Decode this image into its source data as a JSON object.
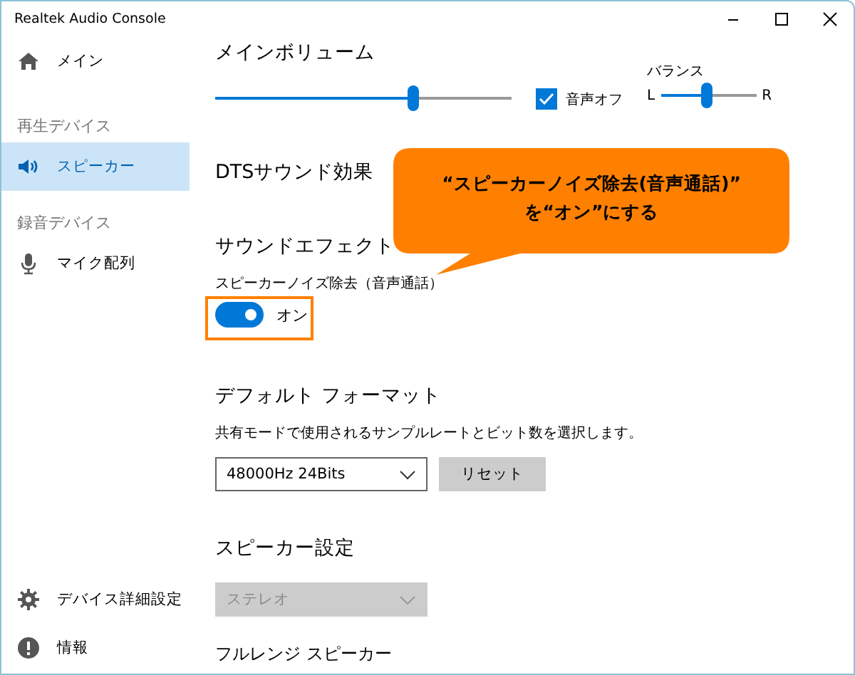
{
  "window": {
    "title": "Realtek Audio Console"
  },
  "sidebar": {
    "items": [
      {
        "kind": "link",
        "label": "メイン",
        "selected": false
      },
      {
        "kind": "header",
        "label": "再生デバイス"
      },
      {
        "kind": "link",
        "label": "スピーカー",
        "selected": true
      },
      {
        "kind": "header",
        "label": "録音デバイス"
      },
      {
        "kind": "link",
        "label": "マイク配列",
        "selected": false
      }
    ],
    "bottom_items": [
      {
        "kind": "link",
        "label": "デバイス詳細設定",
        "selected": false
      },
      {
        "kind": "link",
        "label": "情報",
        "selected": false
      }
    ]
  },
  "main_volume": {
    "title": "メインボリューム",
    "level": 0.67,
    "mute": {
      "label": "音声オフ",
      "checked": true
    },
    "balance": {
      "label": "バランス",
      "left": "L",
      "right": "R",
      "level": 0.49
    }
  },
  "dts": {
    "title": "DTSサウンド効果"
  },
  "sound_effect": {
    "title": "サウンドエフェクト",
    "option": {
      "label": "スピーカーノイズ除去（音声通話）",
      "on": true,
      "state_label": "オン"
    }
  },
  "default_format": {
    "title": "デフォルト フォーマット",
    "description": "共有モードで使用されるサンプルレートとビット数を選択します。",
    "format": {
      "value": "48000Hz 24Bits",
      "disabled": false
    },
    "reset_button": "リセット"
  },
  "speaker_settings": {
    "title": "スピーカー設定",
    "configuration": {
      "value": "ステレオ",
      "disabled": true
    },
    "subtitle": "フルレンジ スピーカー"
  },
  "annotation": {
    "callout_lines": [
      "“スピーカーノイズ除去(音声通話)”",
      "を“オン”にする"
    ],
    "highlight": true
  }
}
